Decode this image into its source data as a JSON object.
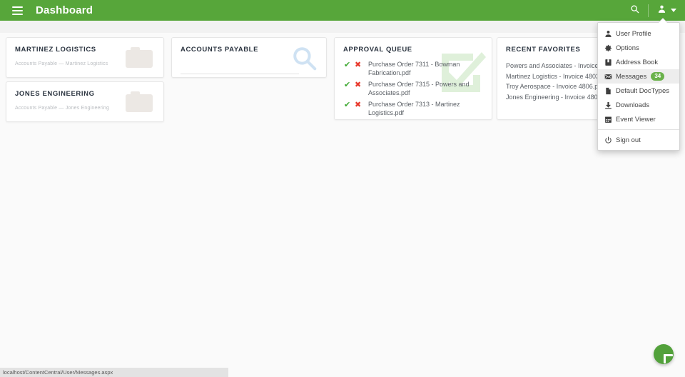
{
  "appbar": {
    "menu_icon": "hamburger-icon",
    "title": "Dashboard",
    "search_icon": "search-icon",
    "user_icon": "user-icon",
    "caret_icon": "chevron-down-icon",
    "background_color": "#57a63a"
  },
  "cards": {
    "folders": [
      {
        "title": "MARTINEZ LOGISTICS",
        "subtitle": "Accounts Payable — Martinez Logistics",
        "icon": "folder-icon"
      },
      {
        "title": "JONES ENGINEERING",
        "subtitle": "Accounts Payable — Jones Engineering",
        "icon": "folder-icon"
      }
    ],
    "accounts_payable": {
      "title": "ACCOUNTS PAYABLE",
      "search_value": "",
      "search_placeholder": "",
      "search_icon": "search-icon"
    },
    "approval_queue": {
      "title": "APPROVAL QUEUE",
      "watermark_icon": "checkbox-check-icon",
      "approve_icon": "check-icon",
      "reject_icon": "x-icon",
      "items": [
        "Purchase Order 7311 - Bowman Fabrication.pdf",
        "Purchase Order 7315 - Powers and Associates.pdf",
        "Purchase Order 7313 - Martinez Logistics.pdf"
      ]
    },
    "recent_favorites": {
      "title": "RECENT FAVORITES",
      "items": [
        "Powers and Associates - Invoice 4805.pdf",
        "Martinez Logistics - Invoice 4803.pdf",
        "Troy Aerospace - Invoice 4806.pdf",
        "Jones Engineering - Invoice 4802.pdf"
      ]
    }
  },
  "user_menu": {
    "items": [
      {
        "label": "User Profile",
        "icon": "user-icon",
        "badge": null,
        "active": false
      },
      {
        "label": "Options",
        "icon": "gear-icon",
        "badge": null,
        "active": false
      },
      {
        "label": "Address Book",
        "icon": "address-book-icon",
        "badge": null,
        "active": false
      },
      {
        "label": "Messages",
        "icon": "envelope-icon",
        "badge": "34",
        "active": true
      },
      {
        "label": "Default DocTypes",
        "icon": "document-icon",
        "badge": null,
        "active": false
      },
      {
        "label": "Downloads",
        "icon": "download-icon",
        "badge": null,
        "active": false
      },
      {
        "label": "Event Viewer",
        "icon": "calendar-icon",
        "badge": null,
        "active": false
      }
    ],
    "signout": {
      "label": "Sign out",
      "icon": "power-icon"
    },
    "badge_color": "#6ab24b"
  },
  "fab": {
    "icon": "plus-icon",
    "color": "#52a13b"
  },
  "statusbar": {
    "url": "localhost/ContentCentral/User/Messages.aspx"
  }
}
